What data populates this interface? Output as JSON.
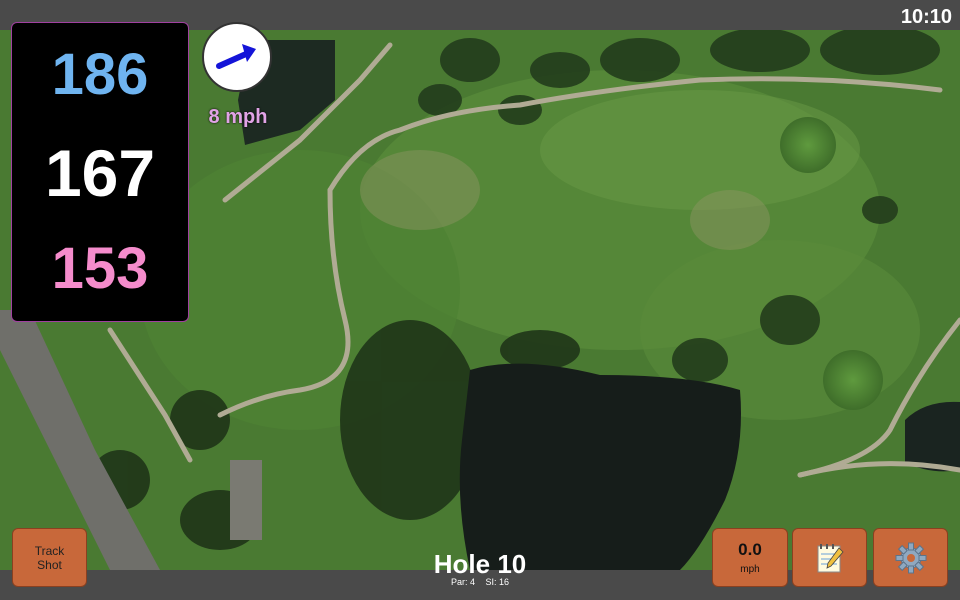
{
  "status": {
    "time": "10:10"
  },
  "yardage": {
    "back": "186",
    "center": "167",
    "front": "153"
  },
  "wind": {
    "speed": "8 mph",
    "icon": "wind-arrow-icon"
  },
  "hole": {
    "title": "Hole 10",
    "par": "Par: 4",
    "stroke_index": "SI: 16"
  },
  "buttons": {
    "track_line1": "Track",
    "track_line2": "Shot",
    "speed_value": "0.0",
    "speed_unit": "mph",
    "notes_icon": "notepad-icon",
    "settings_icon": "gear-icon"
  },
  "colors": {
    "back": "#6fb4f0",
    "center": "#ffffff",
    "front": "#f58ccc",
    "wind_text": "#e1a3e6",
    "button": "#c8683a",
    "arrow": "#1414d8"
  }
}
